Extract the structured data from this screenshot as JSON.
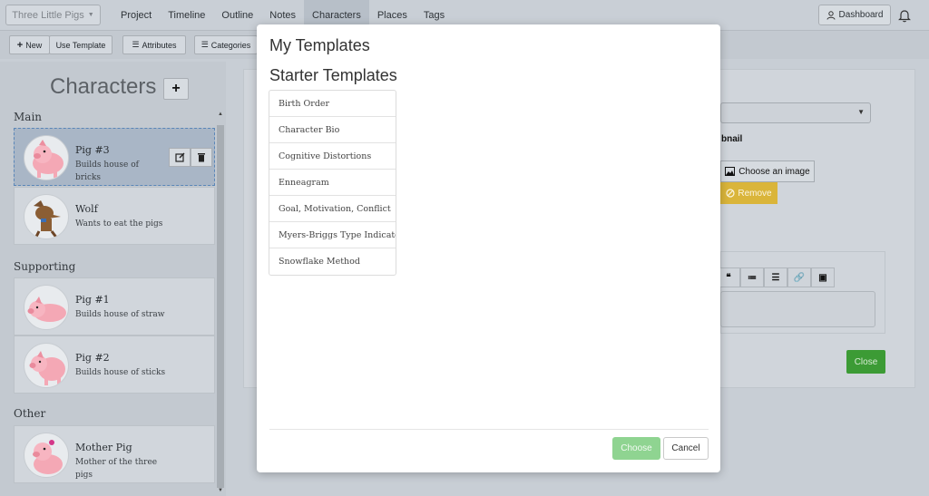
{
  "nav": {
    "project": "Three Little Pigs",
    "links": [
      "Project",
      "Timeline",
      "Outline",
      "Notes",
      "Characters",
      "Places",
      "Tags"
    ],
    "active": "Characters",
    "dashboard": "Dashboard"
  },
  "toolbar": {
    "new": "New",
    "use_template": "Use Template",
    "attributes": "Attributes",
    "categories": "Categories"
  },
  "left": {
    "title": "Characters",
    "sections": {
      "main": "Main",
      "supporting": "Supporting",
      "other": "Other"
    },
    "characters": [
      {
        "name": "Pig #3",
        "desc": "Builds house of bricks"
      },
      {
        "name": "Wolf",
        "desc": "Wants to eat the pigs"
      },
      {
        "name": "Pig #1",
        "desc": "Builds house of straw"
      },
      {
        "name": "Pig #2",
        "desc": "Builds house of sticks"
      },
      {
        "name": "Mother Pig",
        "desc": "Mother of the three pigs"
      }
    ]
  },
  "background_panel": {
    "thumbnail_label": "bnail",
    "choose_image": "Choose an image",
    "remove": "Remove",
    "close": "Close"
  },
  "modal": {
    "title": "My Templates",
    "starter_title": "Starter Templates",
    "templates": [
      "Birth Order",
      "Character Bio",
      "Cognitive Distortions",
      "Enneagram",
      "Goal, Motivation, Conflict",
      "Myers-Briggs Type Indicator",
      "Snowflake Method"
    ],
    "choose": "Choose",
    "cancel": "Cancel"
  },
  "colors": {
    "accent_green": "#3c9b35",
    "warning_yellow": "#dab53a",
    "selected_card": "#a9b6c6"
  }
}
